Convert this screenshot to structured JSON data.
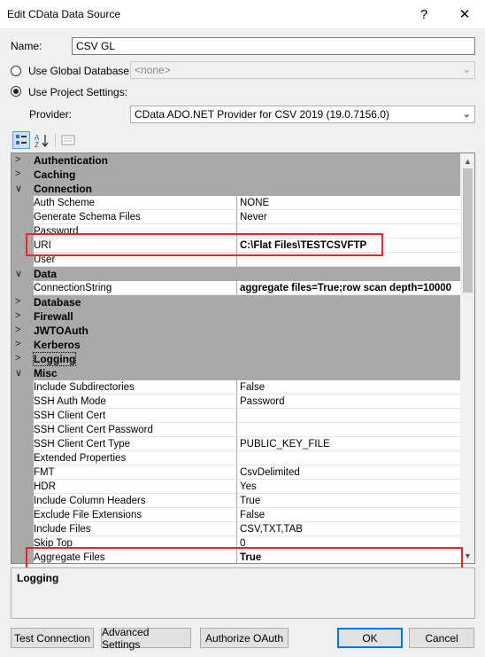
{
  "window": {
    "title": "Edit CData Data Source",
    "help_label": "?",
    "close_label": "✕"
  },
  "form": {
    "name_label": "Name:",
    "name_value": "CSV GL",
    "global_db_label": "Use Global Database:",
    "global_db_value": "<none>",
    "project_settings_label": "Use Project Settings:",
    "provider_label": "Provider:",
    "provider_value": "CData ADO.NET Provider for CSV 2019 (19.0.7156.0)"
  },
  "grid": {
    "rows": [
      {
        "type": "cat",
        "expanded": false,
        "name": "Authentication"
      },
      {
        "type": "cat",
        "expanded": false,
        "name": "Caching"
      },
      {
        "type": "cat",
        "expanded": true,
        "name": "Connection"
      },
      {
        "type": "prop",
        "name": "Auth Scheme",
        "value": "NONE"
      },
      {
        "type": "prop",
        "name": "Generate Schema Files",
        "value": "Never"
      },
      {
        "type": "prop",
        "name": "Password",
        "value": ""
      },
      {
        "type": "prop",
        "name": "URI",
        "value": "C:\\Flat Files\\TESTCSVFTP"
      },
      {
        "type": "prop",
        "name": "User",
        "value": ""
      },
      {
        "type": "cat",
        "expanded": true,
        "name": "Data"
      },
      {
        "type": "prop",
        "name": "ConnectionString",
        "value": "aggregate files=True;row scan depth=10000"
      },
      {
        "type": "cat",
        "expanded": false,
        "name": "Database"
      },
      {
        "type": "cat",
        "expanded": false,
        "name": "Firewall"
      },
      {
        "type": "cat",
        "expanded": false,
        "name": "JWTOAuth"
      },
      {
        "type": "cat",
        "expanded": false,
        "name": "Kerberos"
      },
      {
        "type": "cat",
        "expanded": false,
        "name": "Logging"
      },
      {
        "type": "cat",
        "expanded": true,
        "name": "Misc"
      },
      {
        "type": "prop",
        "name": "Include Subdirectories",
        "value": "False"
      },
      {
        "type": "prop",
        "name": "SSH Auth Mode",
        "value": "Password"
      },
      {
        "type": "prop",
        "name": "SSH Client Cert",
        "value": ""
      },
      {
        "type": "prop",
        "name": "SSH Client Cert Password",
        "value": ""
      },
      {
        "type": "prop",
        "name": "SSH Client Cert Type",
        "value": "PUBLIC_KEY_FILE"
      },
      {
        "type": "prop",
        "name": "Extended Properties",
        "value": ""
      },
      {
        "type": "prop",
        "name": "FMT",
        "value": "CsvDelimited"
      },
      {
        "type": "prop",
        "name": "HDR",
        "value": "Yes"
      },
      {
        "type": "prop",
        "name": "Include Column Headers",
        "value": "True"
      },
      {
        "type": "prop",
        "name": "Exclude File Extensions",
        "value": "False"
      },
      {
        "type": "prop",
        "name": "Include Files",
        "value": "CSV,TXT,TAB"
      },
      {
        "type": "prop",
        "name": "Skip Top",
        "value": "0"
      },
      {
        "type": "prop",
        "name": "Aggregate Files",
        "value": "True"
      }
    ]
  },
  "description": {
    "title": "Logging"
  },
  "buttons": {
    "test_connection": "Test Connection",
    "advanced_settings": "Advanced Settings",
    "authorize_oauth": "Authorize OAuth",
    "ok": "OK",
    "cancel": "Cancel"
  },
  "icons": {
    "categorized": "categorized-icon",
    "alphabetical": "sort-alpha-icon",
    "property_pages": "property-pages-icon"
  },
  "colors": {
    "highlight": "#e0282f",
    "category_bg": "#a9a9a9"
  }
}
